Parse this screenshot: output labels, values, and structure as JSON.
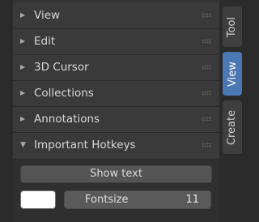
{
  "panel": {
    "sections": [
      {
        "label": "View",
        "expanded": false
      },
      {
        "label": "Edit",
        "expanded": false
      },
      {
        "label": "3D Cursor",
        "expanded": false
      },
      {
        "label": "Collections",
        "expanded": false
      },
      {
        "label": "Annotations",
        "expanded": false
      },
      {
        "label": "Important Hotkeys",
        "expanded": true
      }
    ],
    "show_text_button": "Show text",
    "fontsize": {
      "label": "Fontsize",
      "value": "11"
    },
    "color_swatch": "#ffffff"
  },
  "tabs": [
    {
      "label": "Tool",
      "active": false
    },
    {
      "label": "View",
      "active": true
    },
    {
      "label": "Create",
      "active": false
    }
  ],
  "colors": {
    "accent": "#4b77b3"
  },
  "icons": {
    "collapsed": "triangle-right-icon",
    "expanded": "triangle-down-icon",
    "grip": "drag-grip-icon"
  }
}
